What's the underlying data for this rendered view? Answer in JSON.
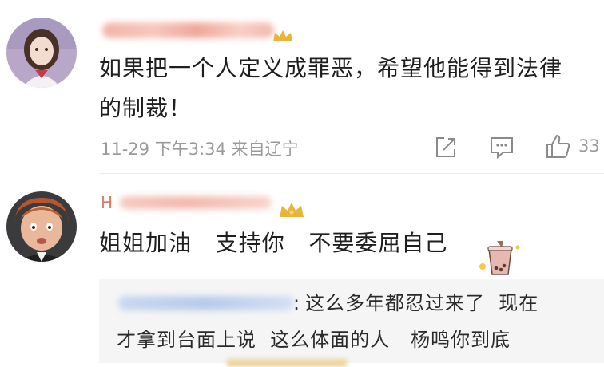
{
  "comments": [
    {
      "author": "",
      "text_line1": "如果把一个人定义成罪恶，希望他能得到法律",
      "text_line2": "的制裁！",
      "date": "11-29",
      "time": "下午3:34",
      "location": "来自辽宁",
      "like_count": "33"
    },
    {
      "author_prefix": "H",
      "text": "姐姐加油   支持你   不要委屈自己",
      "reply": {
        "author_suffix": ":",
        "text_line1": "这么多年都忍过来了  现在",
        "text_line2": "才拿到台面上说  这么体面的人   杨鸣你到底"
      }
    }
  ],
  "icons": {
    "share": "share-icon",
    "comment": "comment-icon",
    "like": "thumbs-up-icon",
    "crown": "crown-icon",
    "sticker": "bubble-tea-icon"
  },
  "colors": {
    "meta_gray": "#9a9a9a",
    "crown_gold": "#e9b43c"
  }
}
